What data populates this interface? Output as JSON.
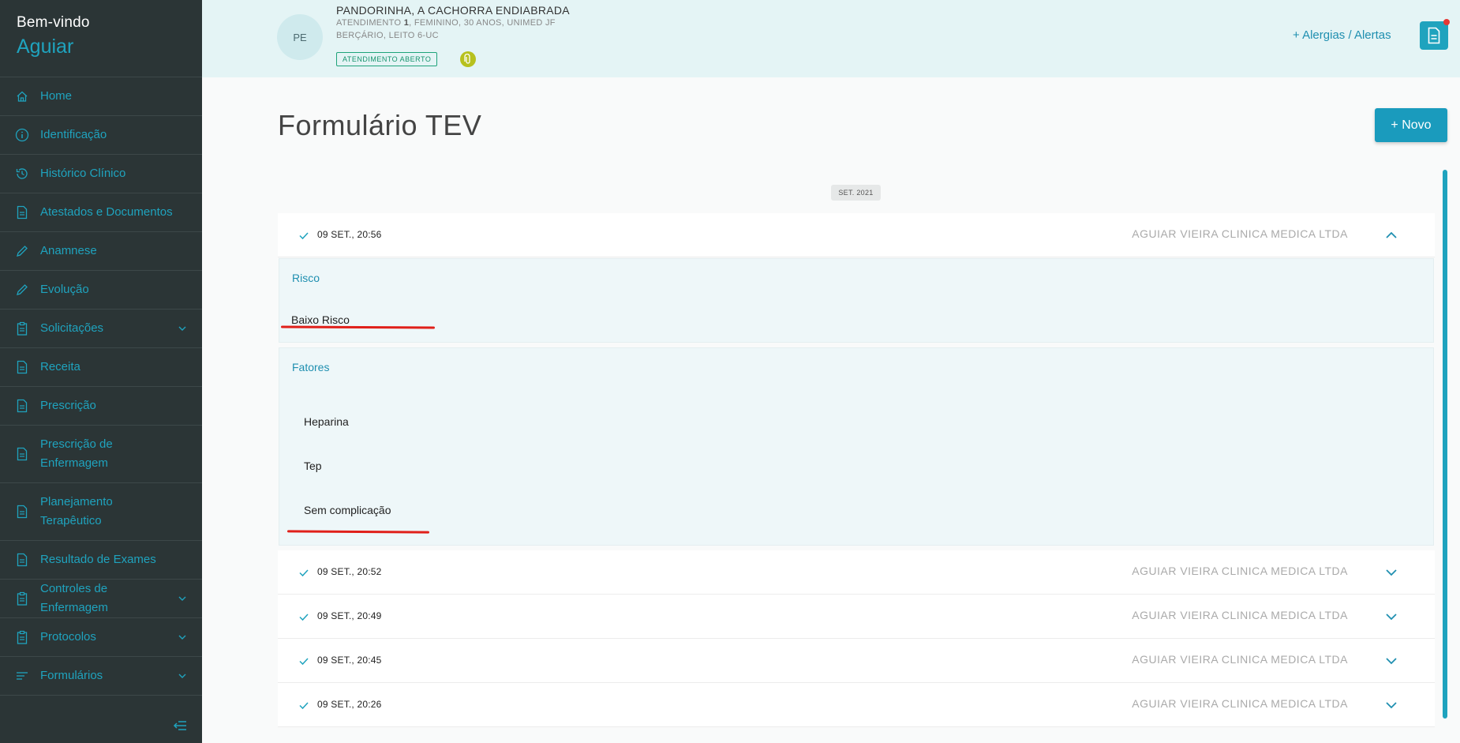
{
  "sidebar": {
    "welcome": "Bem-vindo",
    "user": "Aguiar",
    "items": [
      {
        "label": "Home",
        "icon": "home-icon"
      },
      {
        "label": "Identificação",
        "icon": "info-icon"
      },
      {
        "label": "Histórico Clínico",
        "icon": "history-icon"
      },
      {
        "label": "Atestados e Documentos",
        "icon": "document-icon"
      },
      {
        "label": "Anamnese",
        "icon": "pencil-icon"
      },
      {
        "label": "Evolução",
        "icon": "pencil-icon"
      },
      {
        "label": "Solicitações",
        "icon": "clipboard-icon",
        "expandable": true
      },
      {
        "label": "Receita",
        "icon": "document-icon"
      },
      {
        "label": "Prescrição",
        "icon": "document-icon"
      },
      {
        "label": "Prescrição de Enfermagem",
        "icon": "document-icon"
      },
      {
        "label": "Planejamento Terapêutico",
        "icon": "document-icon"
      },
      {
        "label": "Resultado de Exames",
        "icon": "document-icon"
      },
      {
        "label": "Controles de Enfermagem",
        "icon": "clipboard-icon",
        "expandable": true
      },
      {
        "label": "Protocolos",
        "icon": "clipboard-icon",
        "expandable": true
      },
      {
        "label": "Formulários",
        "icon": "list-icon",
        "expandable": true
      }
    ]
  },
  "patient": {
    "initials": "PE",
    "name": "PANDORINHA, A CACHORRA ENDIABRADA",
    "info_prefix": "ATENDIMENTO ",
    "info_number": "1",
    "info_suffix": ", FEMININO, 30 ANOS, UNIMED JF",
    "location": "BERÇÁRIO, LEITO 6-UC",
    "status": "ATENDIMENTO ABERTO"
  },
  "header": {
    "allergies_label": "+  Alergias / Alertas"
  },
  "main": {
    "title": "Formulário TEV",
    "new_button": "+  Novo",
    "date_group": "SET. 2021",
    "records": [
      {
        "datetime": "09 SET., 20:56",
        "org": "AGUIAR VIEIRA CLINICA MEDICA LTDA",
        "expanded": true
      },
      {
        "datetime": "09 SET., 20:52",
        "org": "AGUIAR VIEIRA CLINICA MEDICA LTDA",
        "expanded": false
      },
      {
        "datetime": "09 SET., 20:49",
        "org": "AGUIAR VIEIRA CLINICA MEDICA LTDA",
        "expanded": false
      },
      {
        "datetime": "09 SET., 20:45",
        "org": "AGUIAR VIEIRA CLINICA MEDICA LTDA",
        "expanded": false
      },
      {
        "datetime": "09 SET., 20:26",
        "org": "AGUIAR VIEIRA CLINICA MEDICA LTDA",
        "expanded": false
      }
    ],
    "detail": {
      "risk_title": "Risco",
      "risk_value": "Baixo Risco",
      "factors_title": "Fatores",
      "factors": [
        "Heparina",
        "Tep",
        "Sem complicação"
      ]
    }
  },
  "colors": {
    "sidebar_bg": "#2b3536",
    "accent": "#1fa3be",
    "header_bg": "#e4f4f5",
    "status_green": "#1fa37a",
    "alert_red": "#e53935",
    "annotation_red": "#e0201a"
  }
}
